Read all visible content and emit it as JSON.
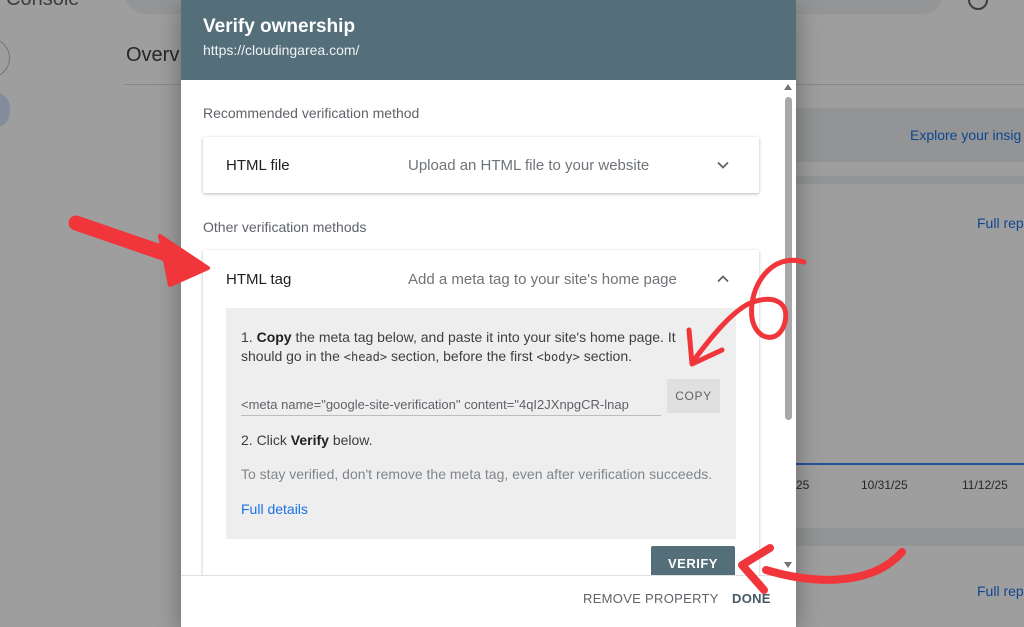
{
  "background": {
    "brand": "Console",
    "overview": "Overv",
    "explore_link": "Explore your insig",
    "full_report_1": "Full rep",
    "full_report_2": "Full rep",
    "tick_a": "25",
    "tick_b": "10/31/25",
    "tick_c": "11/12/25"
  },
  "dialog": {
    "title": "Verify ownership",
    "site_url": "https://cloudingarea.com/",
    "recommended_label": "Recommended verification method",
    "other_label": "Other verification methods",
    "html_file": {
      "name": "HTML file",
      "description": "Upload an HTML file to your website"
    },
    "html_tag": {
      "name": "HTML tag",
      "description": "Add a meta tag to your site's home page",
      "step1_prefix": "1. ",
      "step1_bold": "Copy",
      "step1_text_a": " the meta tag below, and paste it into your site's home page. It should go in the ",
      "step1_code_head": "<head>",
      "step1_text_b": " section, before the first ",
      "step1_code_body": "<body>",
      "step1_text_c": " section.",
      "meta_tag_value": "<meta name=\"google-site-verification\" content=\"4qI2JXnpgCR-lnap",
      "copy_label": "COPY",
      "step2_prefix": "2. Click ",
      "step2_bold": "Verify",
      "step2_suffix": " below.",
      "note": "To stay verified, don't remove the meta tag, even after verification succeeds.",
      "full_details": "Full details",
      "verify_label": "VERIFY"
    },
    "footer": {
      "remove_label": "REMOVE PROPERTY",
      "done_label": "DONE"
    }
  },
  "icons": {
    "expand": "chevron-down-icon",
    "collapse": "chevron-up-icon"
  },
  "colors": {
    "header": "#546e7a",
    "link": "#1a73e8",
    "annotation": "#f0363a"
  }
}
